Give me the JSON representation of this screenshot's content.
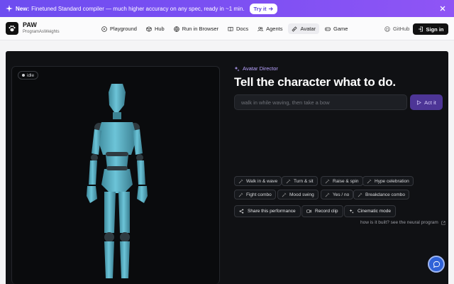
{
  "banner": {
    "new_label": "New:",
    "message": "Finetuned Standard compiler — much higher accuracy on any spec, ready in ~1 min.",
    "cta": "Try it"
  },
  "brand": {
    "name": "PAW",
    "subtitle": "ProgramAsWeights"
  },
  "nav": {
    "items": [
      {
        "label": "Playground",
        "icon": "play-icon"
      },
      {
        "label": "Hub",
        "icon": "cube-icon"
      },
      {
        "label": "Run in Browser",
        "icon": "globe-icon"
      },
      {
        "label": "Docs",
        "icon": "book-icon"
      },
      {
        "label": "Agents",
        "icon": "users-icon"
      },
      {
        "label": "Avatar",
        "icon": "avatar-icon",
        "active": true
      },
      {
        "label": "Game",
        "icon": "gamepad-icon"
      }
    ],
    "github": "GitHub",
    "signin": "Sign in"
  },
  "viewport": {
    "state": "idle"
  },
  "director": {
    "eyebrow": "Avatar Director",
    "headline": "Tell the character what to do.",
    "placeholder": "walk in while waving, then take a bow",
    "act_label": "Act it",
    "presets": [
      "Walk in & wave",
      "Turn & sit",
      "Raise & spin",
      "Hype celebration",
      "Fight combo",
      "Mood swing",
      "Yes / no",
      "Breakdance combo"
    ],
    "actions": [
      "Share this performance",
      "Record clip",
      "Cinematic mode"
    ],
    "how_link": "how is it built? see the neural program"
  },
  "colors": {
    "accent": "#7a4ff2",
    "panel": "#101114",
    "figure": "#5fb8cc"
  }
}
